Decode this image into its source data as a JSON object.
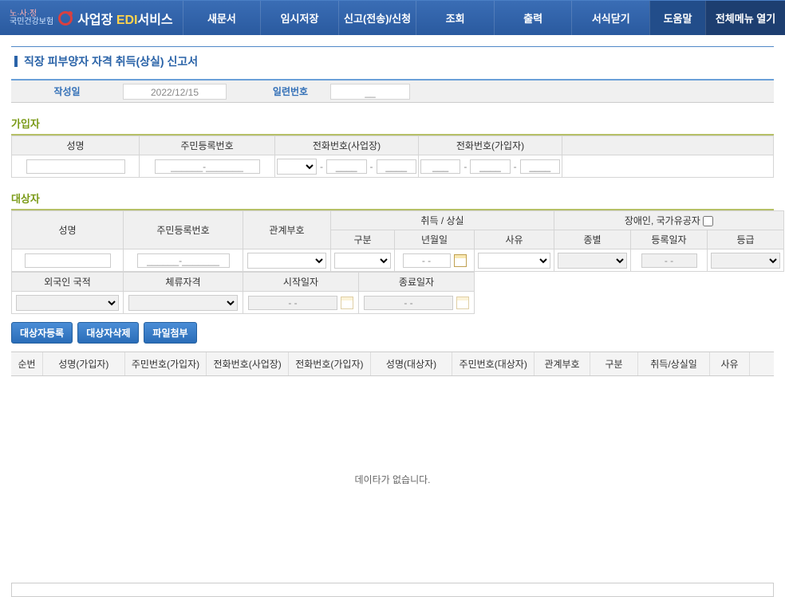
{
  "logo": {
    "line1": "노·사·정",
    "line2": "국민건강보험",
    "service_prefix": "사업장 ",
    "service_edi": "EDI",
    "service_suffix": "서비스"
  },
  "nav": {
    "items": [
      "새문서",
      "임시저장",
      "신고(전송)/신청",
      "조회",
      "출력",
      "서식닫기"
    ],
    "help": "도움말",
    "allmenu": "전체메뉴 열기"
  },
  "page_title": "직장 피부양자 자격 취득(상실) 신고서",
  "info": {
    "date_label": "작성일",
    "date_value": "2022/12/15",
    "serial_label": "일련번호",
    "serial_value": "__"
  },
  "section_subscriber": "가입자",
  "subscriber_headers": {
    "name": "성명",
    "rrn": "주민등록번호",
    "tel_office": "전화번호(사업장)",
    "tel_subscriber": "전화번호(가입자)"
  },
  "subscriber_values": {
    "rrn_placeholder": "______-_______"
  },
  "section_target": "대상자",
  "target_headers": {
    "name": "성명",
    "rrn": "주민등록번호",
    "rel": "관계부호",
    "acq_loss": "취득 / 상실",
    "cls": "구분",
    "ymd": "년월일",
    "reason": "사유",
    "disabled": "장애인, 국가유공자",
    "kind": "종별",
    "reg_date": "등록일자",
    "grade": "등급"
  },
  "target_row2_headers": {
    "nationality": "외국인 국적",
    "stay": "체류자격",
    "start": "시작일자",
    "end": "종료일자"
  },
  "target_values": {
    "rrn_placeholder": "______-_______",
    "date_placeholder": "- -"
  },
  "buttons": {
    "register": "대상자등록",
    "delete": "대상자삭제",
    "attach": "파일첨부"
  },
  "grid_headers": [
    "순번",
    "성명(가입자)",
    "주민번호(가입자)",
    "전화번호(사업장)",
    "전화번호(가입자)",
    "성명(대상자)",
    "주민번호(대상자)",
    "관계부호",
    "구분",
    "취득/상실일",
    "사유"
  ],
  "grid_empty": "데이타가 없습니다."
}
